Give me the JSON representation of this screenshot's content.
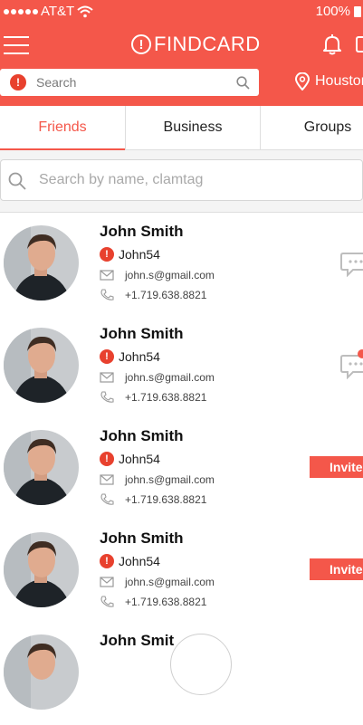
{
  "status_bar": {
    "carrier": "AT&T",
    "battery": "100%"
  },
  "header": {
    "brand_mark": "!",
    "brand": "FINDCARD",
    "search_placeholder": "Search",
    "location": "Houston"
  },
  "tabs": [
    {
      "label": "Friends",
      "active": true
    },
    {
      "label": "Business",
      "active": false
    },
    {
      "label": "Groups",
      "active": false
    }
  ],
  "contacts_search": {
    "placeholder": "Search by name, clamtag"
  },
  "contacts": [
    {
      "name": "John Smith",
      "clamtag": "John54",
      "email": "john.s@gmail.com",
      "phone": "+1.719.638.8821",
      "action": "chat"
    },
    {
      "name": "John Smith",
      "clamtag": "John54",
      "email": "john.s@gmail.com",
      "phone": "+1.719.638.8821",
      "action": "chat"
    },
    {
      "name": "John Smith",
      "clamtag": "John54",
      "email": "john.s@gmail.com",
      "phone": "+1.719.638.8821",
      "action": "Invite"
    },
    {
      "name": "John Smith",
      "clamtag": "John54",
      "email": "john.s@gmail.com",
      "phone": "+1.719.638.8821",
      "action": "Invite"
    },
    {
      "name": "John Smit"
    }
  ],
  "colors": {
    "accent": "#f4574a",
    "alert": "#e8412e"
  },
  "icons": {
    "menu": "hamburger-icon",
    "notifications": "bell-icon",
    "location": "map-pin-icon",
    "search": "search-icon",
    "email": "envelope-icon",
    "phone": "phone-icon",
    "chat": "chat-icon"
  }
}
